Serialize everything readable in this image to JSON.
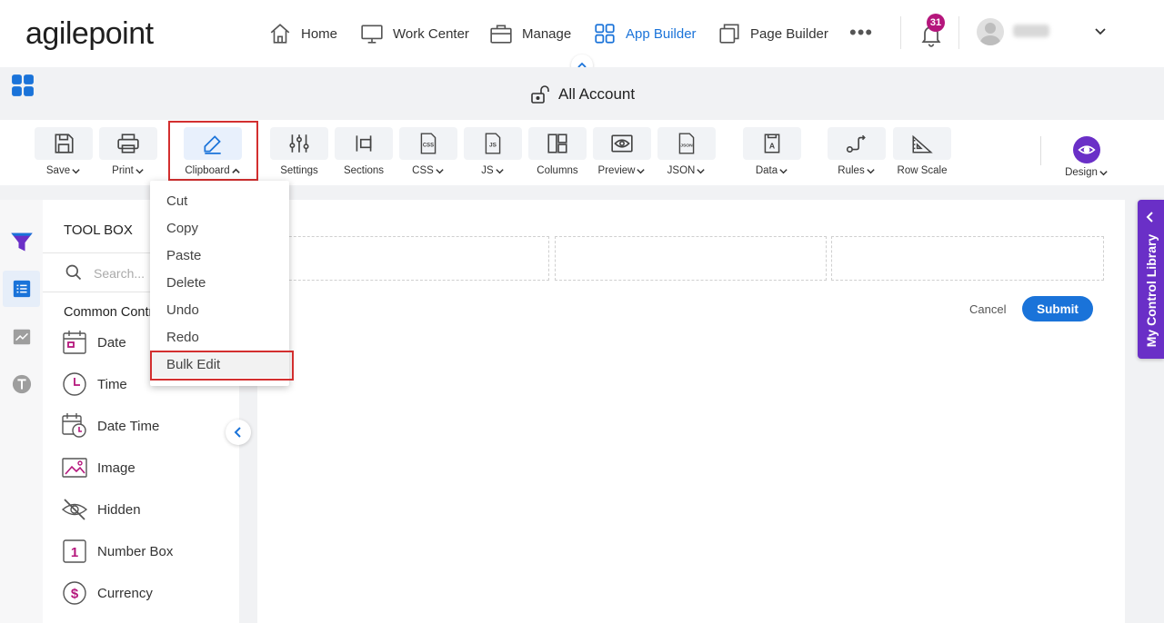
{
  "brand": {
    "logo_text": "agilepoint"
  },
  "nav": {
    "items": [
      {
        "label": "Home",
        "icon": "home-icon"
      },
      {
        "label": "Work Center",
        "icon": "monitor-icon"
      },
      {
        "label": "Manage",
        "icon": "briefcase-icon"
      },
      {
        "label": "App Builder",
        "icon": "grid-icon",
        "active": true
      },
      {
        "label": "Page Builder",
        "icon": "pages-icon"
      }
    ],
    "more": "•••",
    "notifications_count": "31"
  },
  "app": {
    "title": "All Account"
  },
  "ribbon": {
    "save": "Save",
    "print": "Print",
    "clipboard": "Clipboard",
    "settings": "Settings",
    "sections": "Sections",
    "css": "CSS",
    "js": "JS",
    "columns": "Columns",
    "preview": "Preview",
    "json": "JSON",
    "data": "Data",
    "rules": "Rules",
    "row_scale": "Row Scale",
    "design": "Design"
  },
  "clipboard_menu": {
    "items": [
      "Cut",
      "Copy",
      "Paste",
      "Delete",
      "Undo",
      "Redo",
      "Bulk Edit"
    ],
    "highlighted": "Bulk Edit"
  },
  "toolbox": {
    "title": "TOOL BOX",
    "search_placeholder": "Search...",
    "section": "Common Controls",
    "items": [
      "Date",
      "Time",
      "Date Time",
      "Image",
      "Hidden",
      "Number Box",
      "Currency"
    ]
  },
  "form": {
    "cancel": "Cancel",
    "submit": "Submit"
  },
  "control_library": {
    "label": "My Control Library"
  },
  "colors": {
    "accent": "#1a73d9",
    "purple": "#6a2fc7",
    "badge": "#b5167c",
    "highlight_outline": "#d32f2f"
  }
}
